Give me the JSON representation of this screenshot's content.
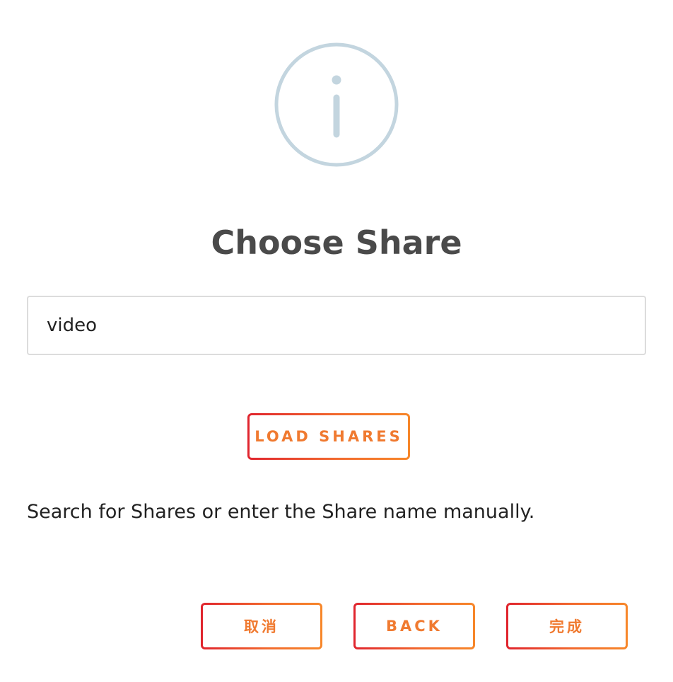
{
  "dialog": {
    "icon": "info-circle-icon",
    "title": "Choose Share",
    "share_input": {
      "value": "video",
      "placeholder": ""
    },
    "load_shares_label": "LOAD SHARES",
    "helper_text": "Search for Shares or enter the Share name manually."
  },
  "footer": {
    "cancel_label": "取消",
    "back_label": "BACK",
    "done_label": "完成"
  },
  "colors": {
    "icon_stroke": "#c3d5df",
    "title": "#4a4a4a",
    "button_text": "#f07a30",
    "button_gradient_start": "#e0242e",
    "button_gradient_end": "#f7872a",
    "input_border": "#dcdcdc"
  }
}
